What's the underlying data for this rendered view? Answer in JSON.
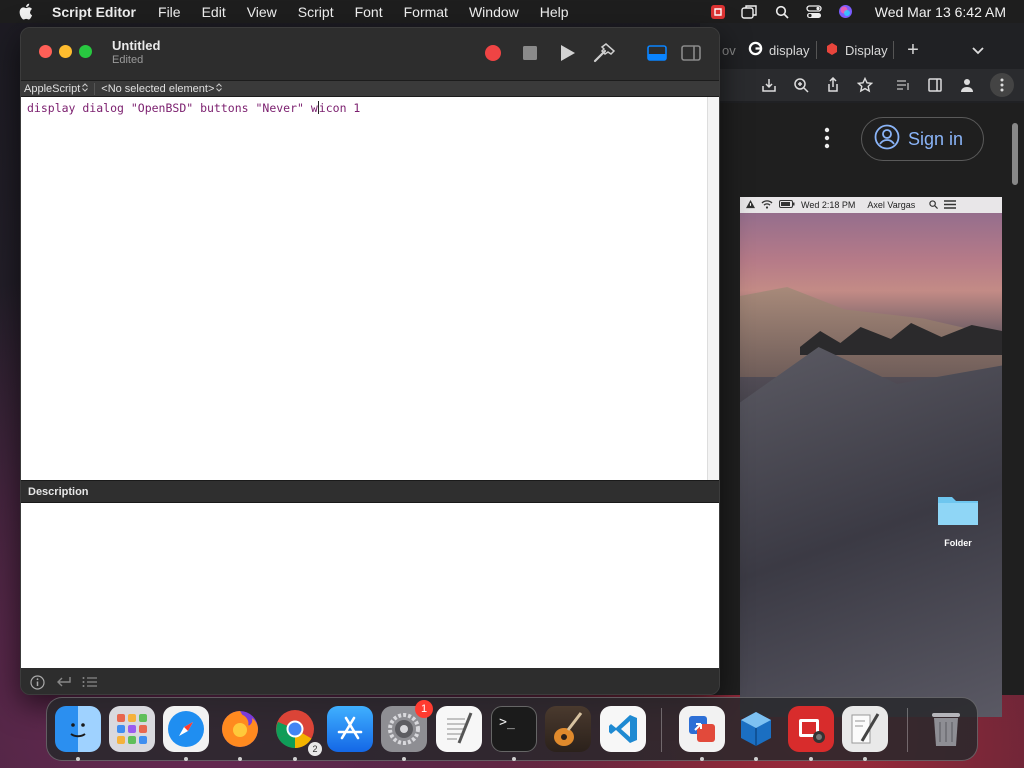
{
  "menubar": {
    "app_name": "Script Editor",
    "items": [
      "File",
      "Edit",
      "View",
      "Script",
      "Font",
      "Format",
      "Window",
      "Help"
    ],
    "clock": "Wed Mar 13  6:42 AM"
  },
  "editor": {
    "title": "Untitled",
    "subtitle": "Edited",
    "language_popup": "AppleScript",
    "element_popup": "<No selected element>",
    "code_before_caret": "display dialog \"OpenBSD\" buttons \"Never\" w",
    "code_after_caret": "icon 1",
    "description_label": "Description"
  },
  "browser": {
    "tabs": [
      {
        "label": "ov"
      },
      {
        "label": "display"
      },
      {
        "label": "Display"
      }
    ],
    "sign_in_label": "Sign in",
    "vm": {
      "menubar_clock": "Wed 2:18 PM",
      "menubar_user": "Axel Vargas",
      "folder_label": "Folder"
    }
  },
  "dock": {
    "apps": [
      {
        "name": "Finder",
        "icon": "finder-icon"
      },
      {
        "name": "Launchpad",
        "icon": "launchpad-icon"
      },
      {
        "name": "Safari",
        "icon": "safari-icon"
      },
      {
        "name": "Firefox",
        "icon": "firefox-icon"
      },
      {
        "name": "Chrome",
        "icon": "chrome-icon",
        "badge": "2"
      },
      {
        "name": "App Store",
        "icon": "app-store-icon"
      },
      {
        "name": "System Settings",
        "icon": "settings-icon",
        "badge": "1"
      },
      {
        "name": "TextEdit",
        "icon": "textedit-icon"
      },
      {
        "name": "Terminal",
        "icon": "terminal-icon",
        "glyph": ">_"
      },
      {
        "name": "GarageBand",
        "icon": "garageband-icon"
      },
      {
        "name": "VS Code",
        "icon": "vscode-icon"
      },
      {
        "name": "Migration",
        "icon": "migration-icon"
      },
      {
        "name": "VirtualBox",
        "icon": "virtualbox-icon"
      },
      {
        "name": "Photo Booth",
        "icon": "photo-booth-icon"
      },
      {
        "name": "Script Editor",
        "icon": "script-editor-icon"
      },
      {
        "name": "Trash",
        "icon": "trash-icon"
      }
    ]
  },
  "colors": {
    "record": "#ef4444",
    "code_text": "#7b1e6e",
    "accent": "#0a84ff"
  }
}
